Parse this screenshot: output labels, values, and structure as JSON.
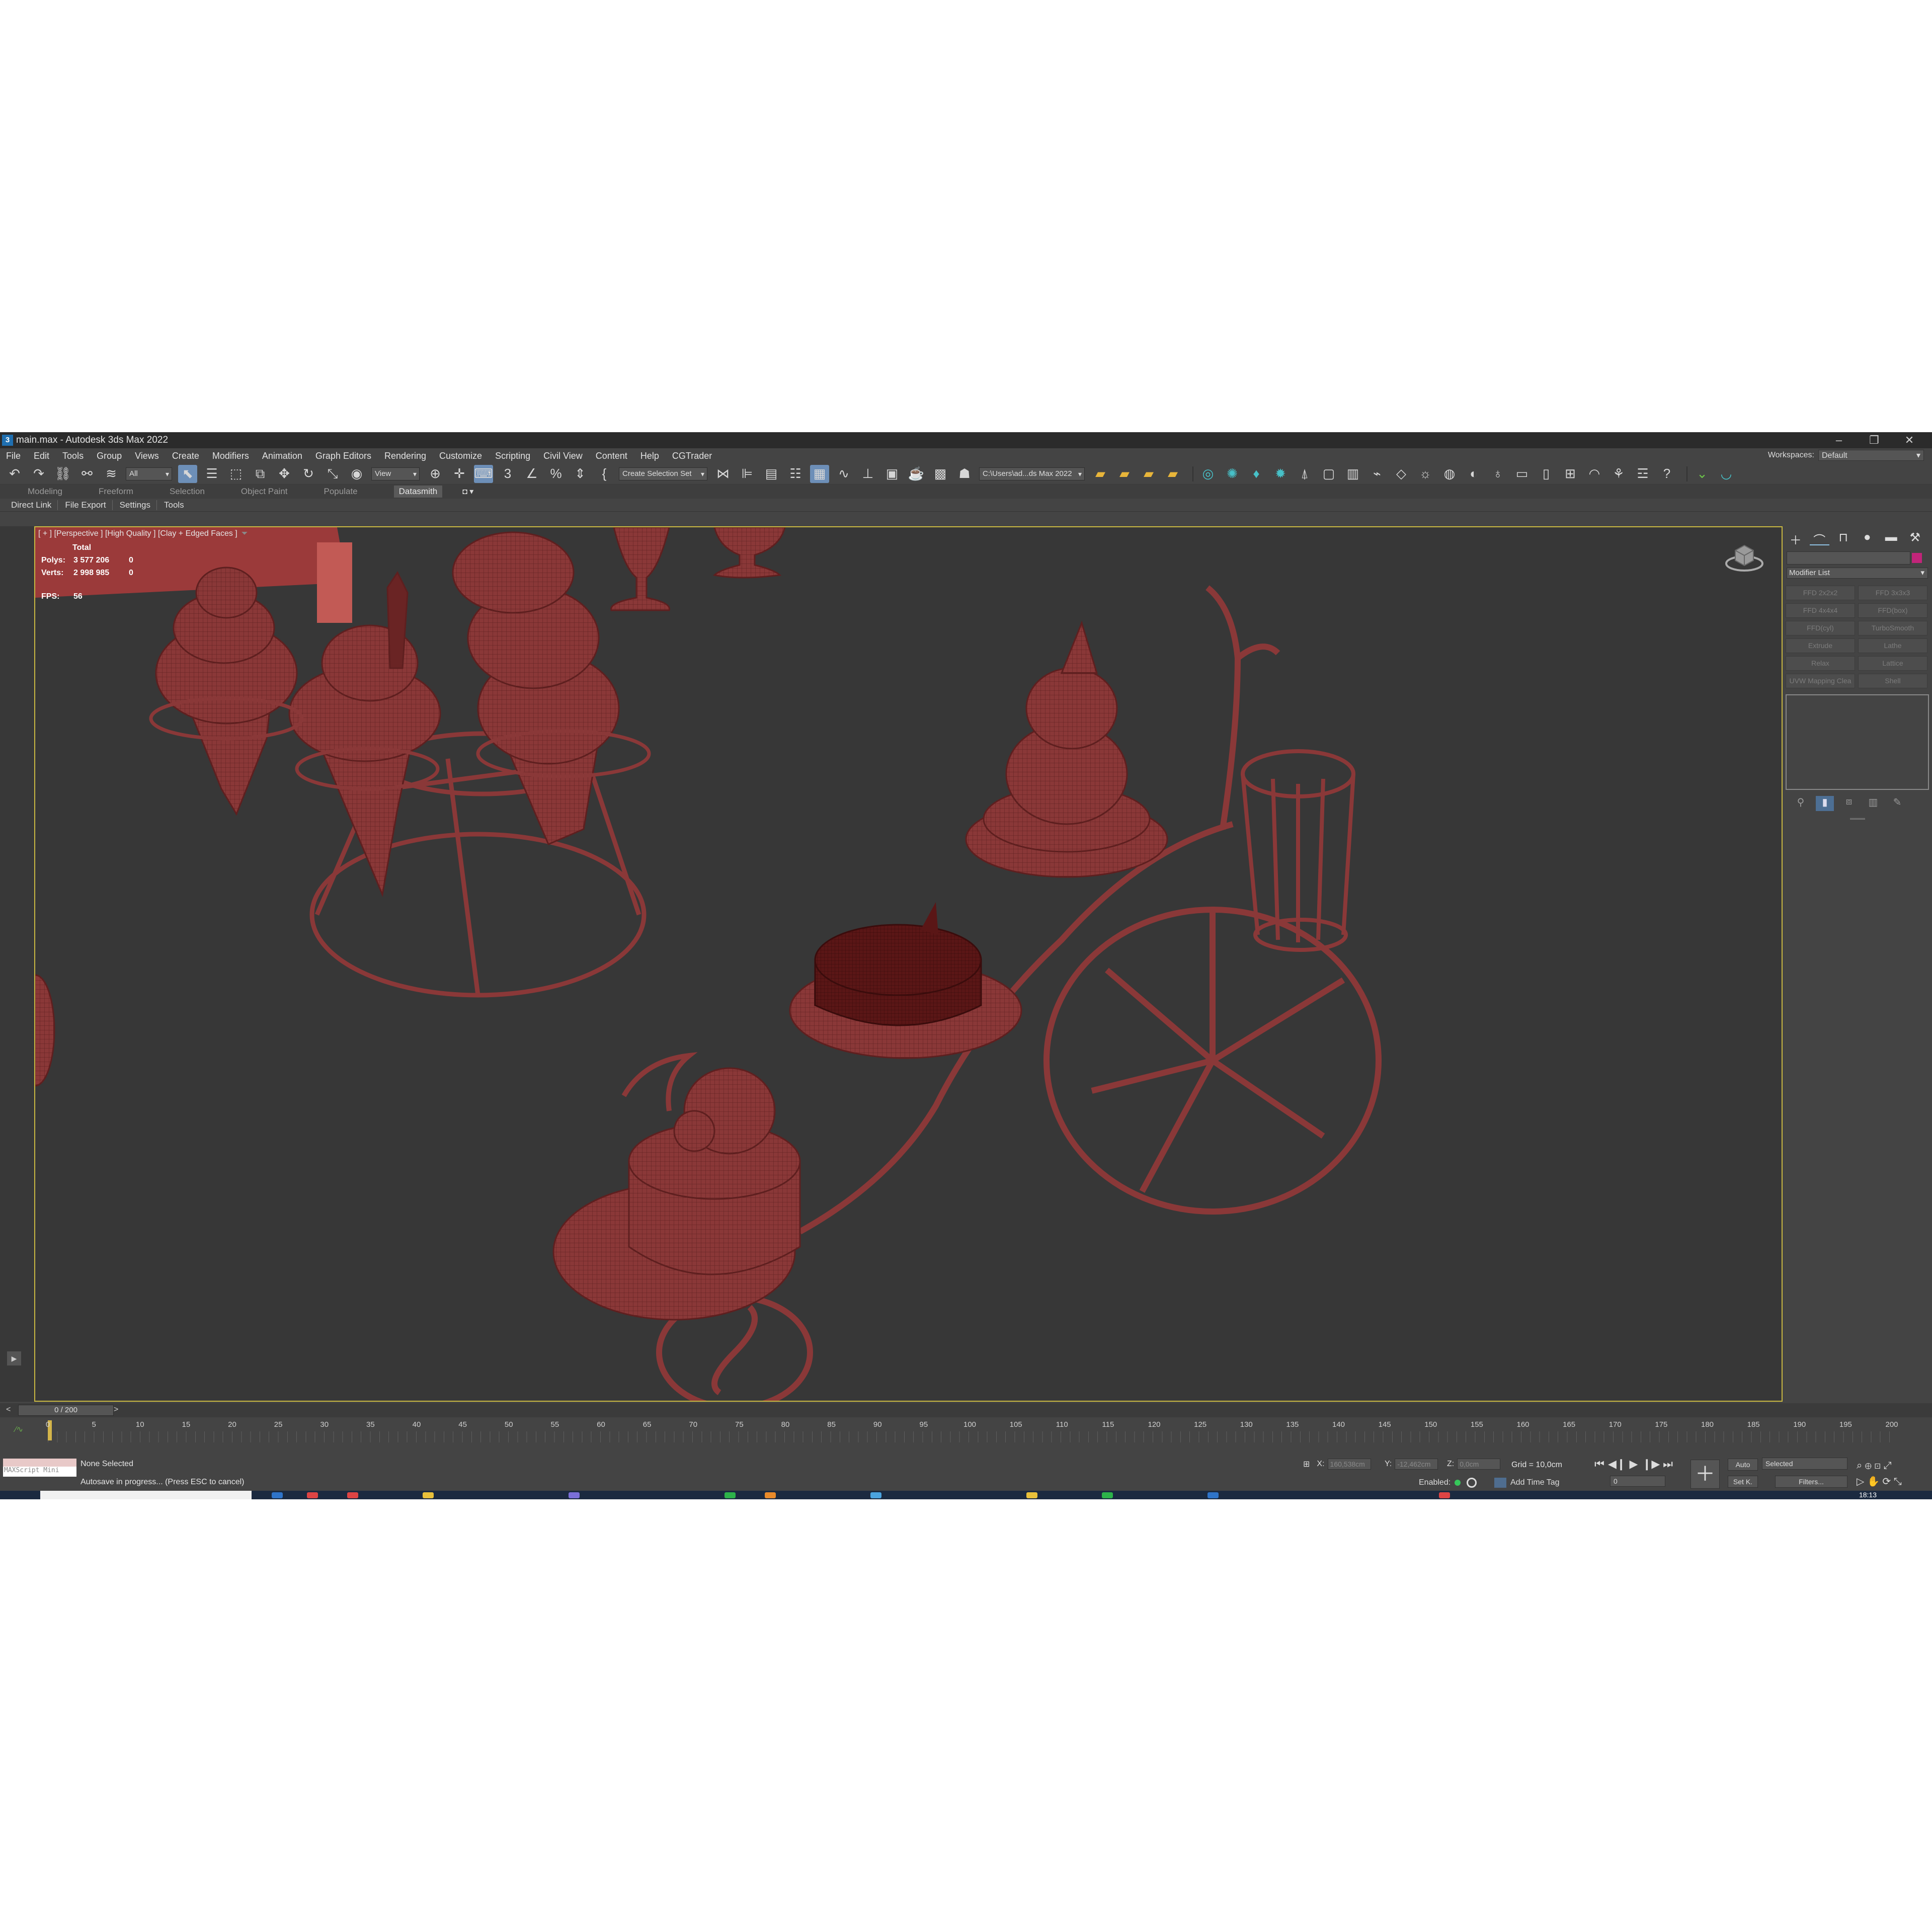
{
  "window": {
    "title": "main.max - Autodesk 3ds Max 2022",
    "icon_text": "3"
  },
  "menu": {
    "items": [
      "File",
      "Edit",
      "Tools",
      "Group",
      "Views",
      "Create",
      "Modifiers",
      "Animation",
      "Graph Editors",
      "Rendering",
      "Customize",
      "Scripting",
      "Civil View",
      "Content",
      "Help",
      "CGTrader"
    ],
    "workspaces_label": "Workspaces:",
    "workspaces_value": "Default"
  },
  "toolbar": {
    "filter_value": "All",
    "refcoord_value": "View",
    "selection_set_value": "Create Selection Set",
    "project_path": "C:\\Users\\ad...ds Max 2022"
  },
  "ribbon": {
    "tabs": [
      "Modeling",
      "Freeform",
      "Selection",
      "Object Paint",
      "Populate",
      "Datasmith"
    ],
    "active_tab": "Datasmith"
  },
  "subbar": {
    "items": [
      "Direct Link",
      "File Export",
      "Settings",
      "Tools"
    ]
  },
  "viewport": {
    "label": "[ + ] [Perspective ] [High Quality ] [Clay + Edged Faces ]",
    "stats": {
      "total_label": "Total",
      "polys_label": "Polys:",
      "polys_value": "3 577 206",
      "polys_sel": "0",
      "verts_label": "Verts:",
      "verts_value": "2 998 985",
      "verts_sel": "0",
      "fps_label": "FPS:",
      "fps_value": "56"
    }
  },
  "command_panel": {
    "modifier_list_label": "Modifier List",
    "modifier_buttons": [
      "FFD 2x2x2",
      "FFD 3x3x3",
      "FFD 4x4x4",
      "FFD(box)",
      "FFD(cyl)",
      "TurboSmooth",
      "Extrude",
      "Lathe",
      "Relax",
      "Lattice",
      "UVW Mapping Clea",
      "Shell"
    ],
    "object_color": "#c2257a"
  },
  "timeslider": {
    "value": "0 / 200",
    "prev": "<",
    "next": ">"
  },
  "trackbar": {
    "ticks": [
      "0",
      "5",
      "10",
      "15",
      "20",
      "25",
      "30",
      "35",
      "40",
      "45",
      "50",
      "55",
      "60",
      "65",
      "70",
      "75",
      "80",
      "85",
      "90",
      "95",
      "100",
      "105",
      "110",
      "115",
      "120",
      "125",
      "130",
      "135",
      "140",
      "145",
      "150",
      "155",
      "160",
      "165",
      "170",
      "175",
      "180",
      "185",
      "190",
      "195",
      "200"
    ]
  },
  "status": {
    "maxscript_label": "MAXScript Mini",
    "selection": "None Selected",
    "prompt": "Autosave in progress... (Press ESC to cancel)",
    "x_label": "X:",
    "x_value": "160,538cm",
    "y_label": "Y:",
    "y_value": "-12,462cm",
    "z_label": "Z:",
    "z_value": "0,0cm",
    "grid": "Grid = 10,0cm",
    "enabled_label": "Enabled:",
    "add_time_tag": "Add Time Tag",
    "auto_label": "Auto",
    "setk_label": "Set K.",
    "key_filter_value": "Selected",
    "filters_label": "Filters...",
    "frame_value": "0"
  },
  "taskbar": {
    "clock": "18:13"
  },
  "colors": {
    "accent": "#6d8fb8",
    "viewport_border": "#c9b842",
    "model": "#8e3b3b"
  }
}
